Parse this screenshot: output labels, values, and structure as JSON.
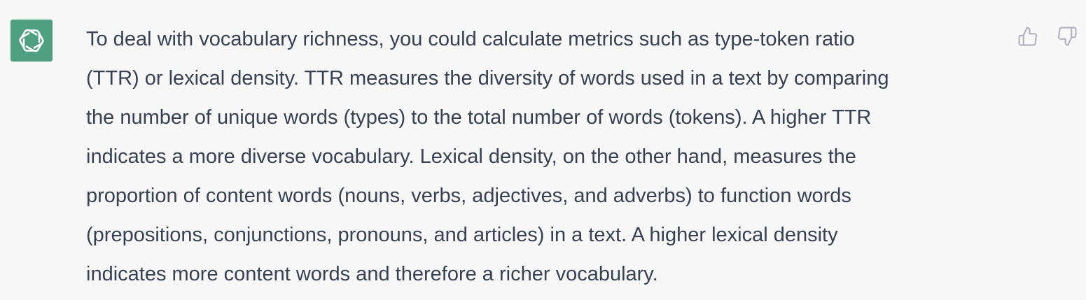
{
  "assistant": {
    "avatar_icon": "openai-logo-icon",
    "avatar_color": "#4f9f83",
    "text_color": "#374151",
    "background": "#f7f7f8",
    "lines": [
      "To deal with vocabulary richness, you could calculate metrics such as type-token ratio",
      "(TTR) or lexical density. TTR measures the diversity of words used in a text by comparing",
      "the number of unique words (types) to the total number of words (tokens). A higher TTR",
      "indicates a more diverse vocabulary. Lexical density, on the other hand, measures the",
      "proportion of content words (nouns, verbs, adjectives, and adverbs) to function words",
      "(prepositions, conjunctions, pronouns, and articles) in a text. A higher lexical density",
      "indicates more content words and therefore a richer vocabulary."
    ]
  },
  "feedback": {
    "like_icon": "thumbs-up-icon",
    "dislike_icon": "thumbs-down-icon",
    "icon_color": "#acacbe"
  }
}
